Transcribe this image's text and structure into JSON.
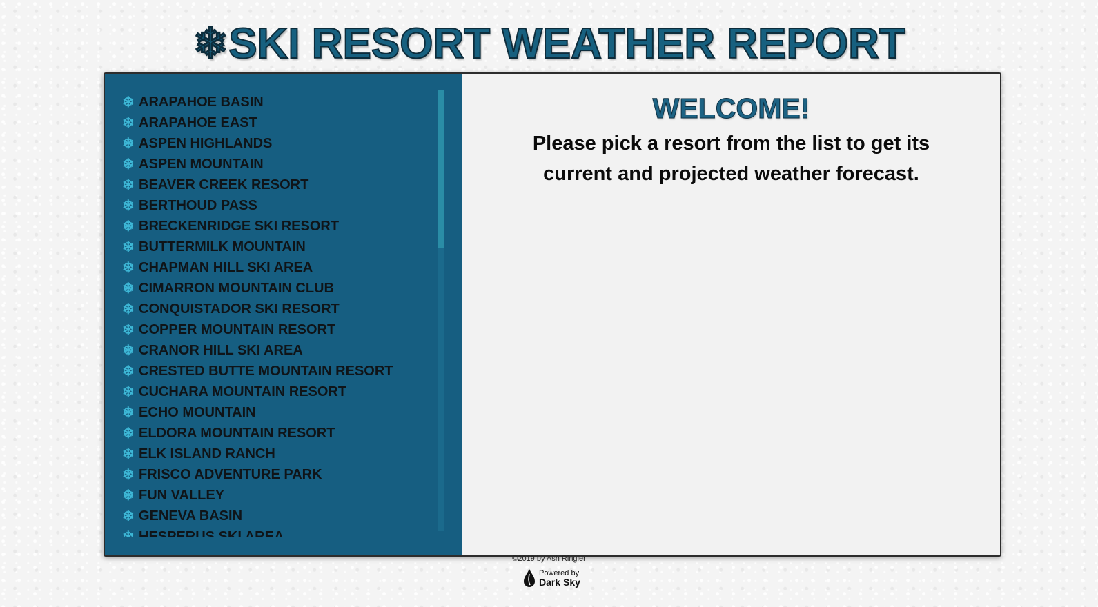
{
  "header": {
    "flake_icon": "❄",
    "title": "SKI RESORT WEATHER REPORT"
  },
  "sidebar": {
    "item_icon": "❄",
    "resorts": [
      "ARAPAHOE BASIN",
      "ARAPAHOE EAST",
      "ASPEN HIGHLANDS",
      "ASPEN MOUNTAIN",
      "BEAVER CREEK RESORT",
      "BERTHOUD PASS",
      "BRECKENRIDGE SKI RESORT",
      "BUTTERMILK MOUNTAIN",
      "CHAPMAN HILL SKI AREA",
      "CIMARRON MOUNTAIN CLUB",
      "CONQUISTADOR SKI RESORT",
      "COPPER MOUNTAIN RESORT",
      "CRANOR HILL SKI AREA",
      "CRESTED BUTTE MOUNTAIN RESORT",
      "CUCHARA MOUNTAIN RESORT",
      "ECHO MOUNTAIN",
      "ELDORA MOUNTAIN RESORT",
      "ELK ISLAND RANCH",
      "FRISCO ADVENTURE PARK",
      "FUN VALLEY",
      "GENEVA BASIN",
      "HESPERUS SKI AREA"
    ]
  },
  "main": {
    "welcome": "WELCOME!",
    "instructions": "Please pick a resort from the list to get its current and projected weather forecast."
  },
  "footer": {
    "copyright": "©2019 by Ash Ringler",
    "powered_small": "Powered by",
    "powered_big": "Dark Sky"
  },
  "colors": {
    "sidebar_bg": "#165e81",
    "title_fill": "#17607f",
    "flake_icon": "#3db7d6",
    "main_bg": "#f2f2f2"
  }
}
